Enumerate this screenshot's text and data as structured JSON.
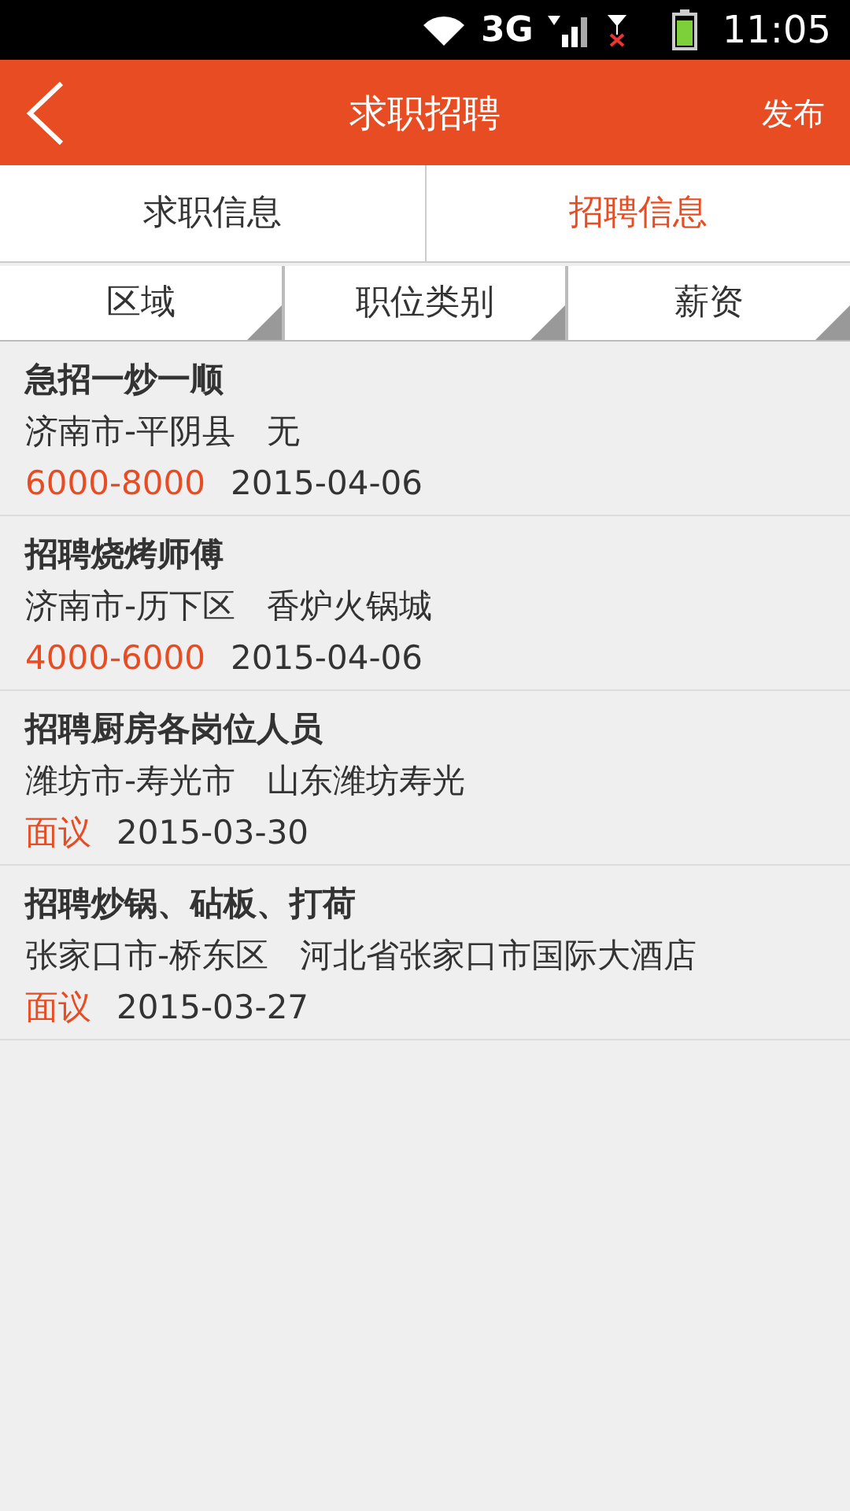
{
  "status_bar": {
    "network": "3G",
    "time": "11:05"
  },
  "header": {
    "title": "求职招聘",
    "action": "发布"
  },
  "tabs": [
    {
      "label": "求职信息",
      "selected": false
    },
    {
      "label": "招聘信息",
      "selected": true
    }
  ],
  "filters": [
    "区域",
    "职位类别",
    "薪资"
  ],
  "listings": [
    {
      "title": "急招一炒一顺",
      "location": "济南市-平阴县",
      "company": "无",
      "salary": "6000-8000",
      "date": "2015-04-06"
    },
    {
      "title": "招聘烧烤师傅",
      "location": "济南市-历下区",
      "company": "香炉火锅城",
      "salary": "4000-6000",
      "date": "2015-04-06"
    },
    {
      "title": "招聘厨房各岗位人员",
      "location": "潍坊市-寿光市",
      "company": "山东潍坊寿光",
      "salary": "面议",
      "date": "2015-03-30"
    },
    {
      "title": "招聘炒锅、砧板、打荷",
      "location": "张家口市-桥东区",
      "company": "河北省张家口市国际大酒店",
      "salary": "面议",
      "date": "2015-03-27"
    }
  ]
}
